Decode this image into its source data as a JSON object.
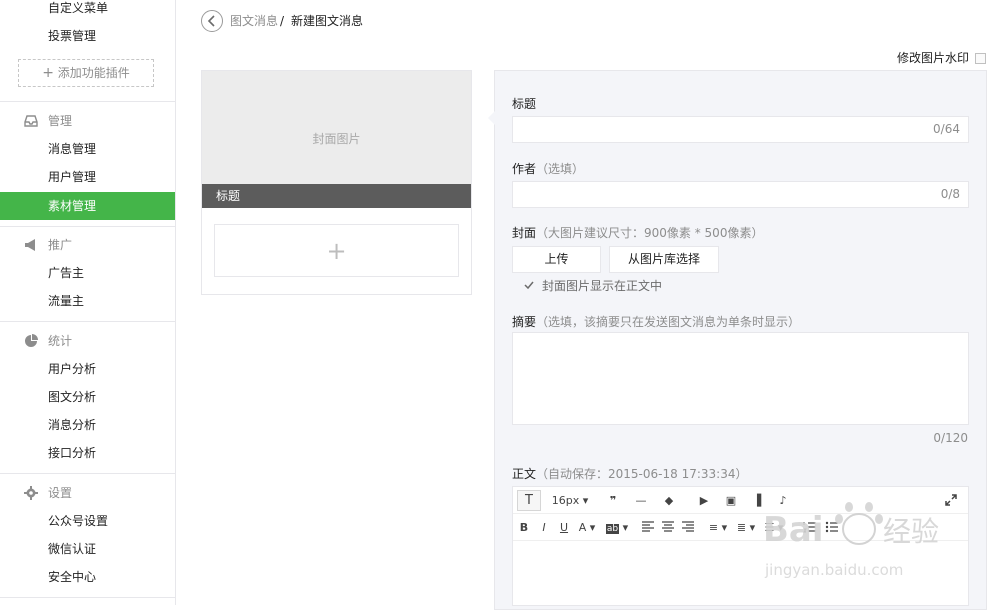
{
  "sidebar": {
    "items_top": [
      {
        "label": "自定义菜单"
      },
      {
        "label": "投票管理"
      }
    ],
    "add_plugin": "添加功能插件",
    "sections": [
      {
        "title": "管理",
        "items": [
          "消息管理",
          "用户管理",
          "素材管理"
        ]
      },
      {
        "title": "推广",
        "items": [
          "广告主",
          "流量主"
        ]
      },
      {
        "title": "统计",
        "items": [
          "用户分析",
          "图文分析",
          "消息分析",
          "接口分析"
        ]
      },
      {
        "title": "设置",
        "items": [
          "公众号设置",
          "微信认证",
          "安全中心"
        ]
      }
    ],
    "active_item": "素材管理"
  },
  "breadcrumb": {
    "parent": "图文消息",
    "separator": "/",
    "current": "新建图文消息"
  },
  "watermark_toggle": "修改图片水印",
  "preview": {
    "cover_placeholder": "封面图片",
    "title_placeholder": "标题",
    "add_label": "+"
  },
  "form": {
    "title_label": "标题",
    "title_count": "0/64",
    "author_label": "作者",
    "author_hint": "（选填）",
    "author_count": "0/8",
    "cover_label": "封面",
    "cover_hint": "（大图片建议尺寸：900像素 * 500像素）",
    "upload_button": "上传",
    "library_button": "从图片库选择",
    "show_cover_checkbox": "封面图片显示在正文中",
    "show_cover_checked": true,
    "summary_label": "摘要",
    "summary_hint": "（选填，该摘要只在发送图文消息为单条时显示）",
    "summary_count": "0/120",
    "body_label": "正文",
    "body_hint": "（自动保存：2015-06-18 17:33:34）"
  },
  "toolbar": {
    "font_size": "16px",
    "row1": [
      "T",
      "16px",
      "❞",
      "—",
      "◆",
      "▶",
      "▣",
      "▐",
      "♪"
    ],
    "row2": [
      "B",
      "I",
      "U",
      "A",
      "ab"
    ]
  },
  "colors": {
    "accent": "#44b549",
    "sidebar_border": "#e7e7eb",
    "editor_bg": "#f4f5f9",
    "cover_title_bg": "#5c5c5c"
  }
}
